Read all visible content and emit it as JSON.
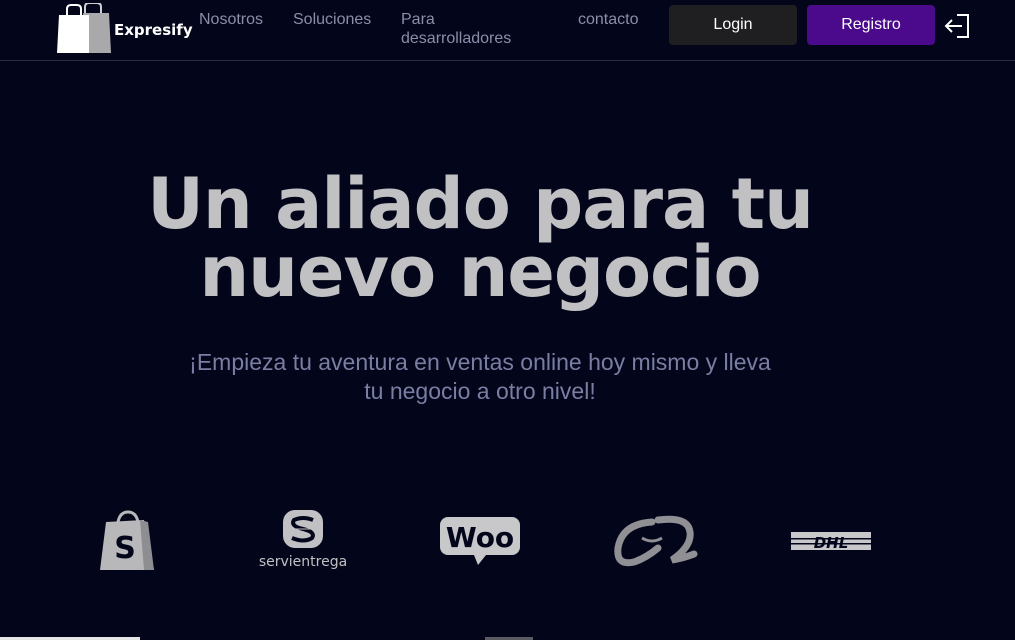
{
  "header": {
    "brand": "Expresify",
    "nav": {
      "nosotros": "Nosotros",
      "soluciones": "Soluciones",
      "para": "Para",
      "desarrolladores": "desarrolladores",
      "contacto": "contacto"
    },
    "login_label": "Login",
    "register_label": "Registro"
  },
  "hero": {
    "title_line1": "Un aliado para tu",
    "title_line2": "nuevo negocio",
    "subtitle_line1": "¡Empieza tu aventura en ventas online hoy mismo y lleva",
    "subtitle_line2": "tu negocio a otro nivel!"
  },
  "partners": {
    "shopify_letter": "S",
    "servientrega": "servientrega",
    "woo": "Woo",
    "dhl": "DHL"
  },
  "colors": {
    "background": "#03051a",
    "title": "#c1c1c4",
    "subtitle": "#7b7ea3",
    "nav_text": "#8b8ea8",
    "register_button": "#4b0a8c",
    "login_button": "#1f1f22",
    "logo_gray": "#a9a9ac"
  },
  "icons": {
    "brand": "shopping-bag-icon",
    "logout": "logout-icon"
  }
}
